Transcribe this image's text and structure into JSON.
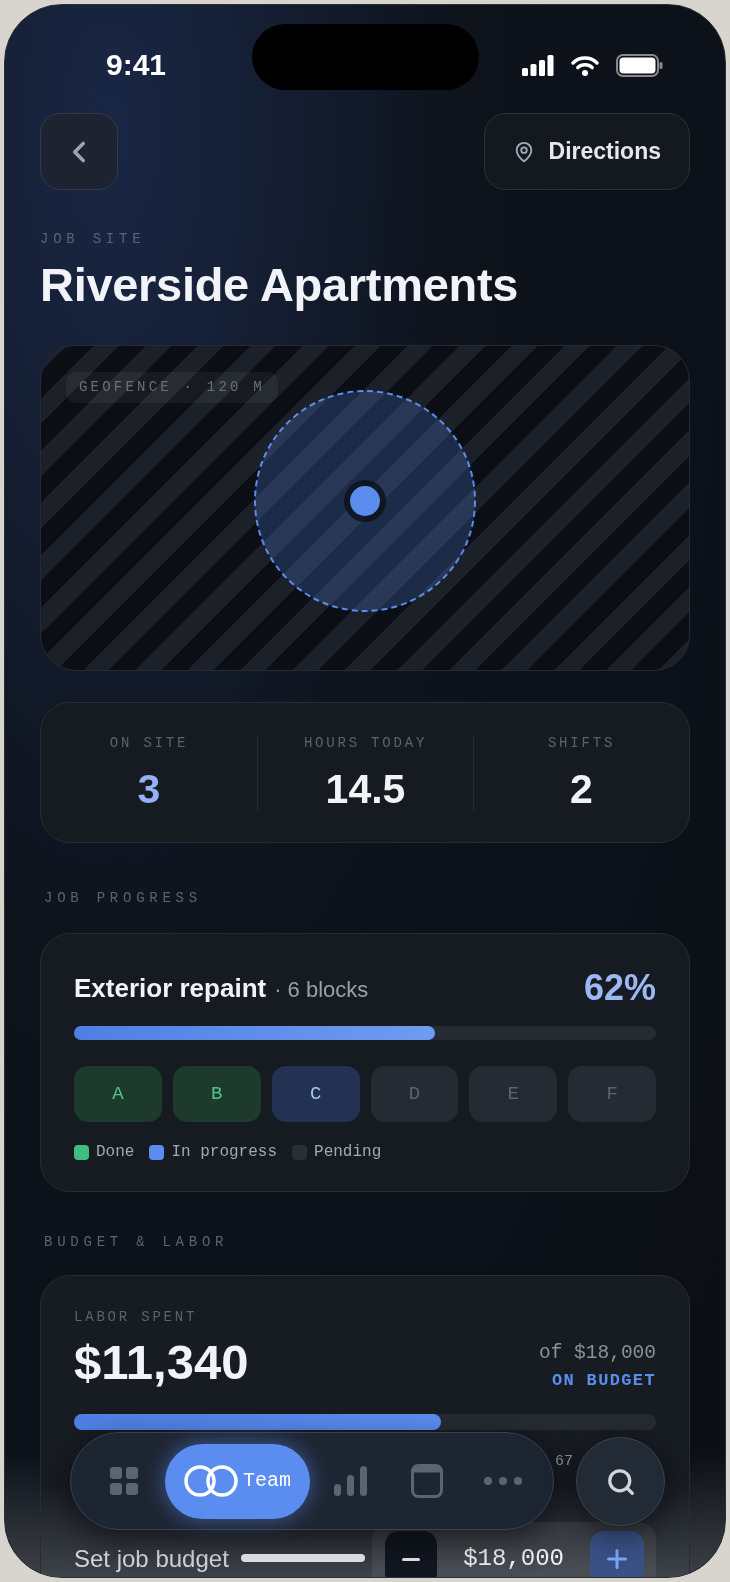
{
  "status_bar": {
    "time": "9:41"
  },
  "header": {
    "directions": "Directions"
  },
  "job_site": {
    "eyebrow": "JOB SITE",
    "title": "Riverside Apartments"
  },
  "map": {
    "label": "GEOFENCE · 120 M"
  },
  "stats": [
    {
      "label": "ON SITE",
      "value": "3",
      "accent": true
    },
    {
      "label": "HOURS TODAY",
      "value": "14.5",
      "accent": false
    },
    {
      "label": "SHIFTS",
      "value": "2",
      "accent": false
    }
  ],
  "job_progress": {
    "heading": "JOB PROGRESS",
    "task": "Exterior repaint",
    "detail": "· 6 blocks",
    "percent": "62%",
    "level": 0.62,
    "blocks": [
      {
        "label": "A",
        "done": true,
        "active": false
      },
      {
        "label": "B",
        "done": true,
        "active": false
      },
      {
        "label": "C",
        "done": false,
        "active": true
      },
      {
        "label": "D",
        "done": false,
        "active": false
      },
      {
        "label": "E",
        "done": false,
        "active": false
      },
      {
        "label": "F",
        "done": false,
        "active": false
      }
    ],
    "legend": [
      {
        "label": "Done",
        "color": "#3fbf7f"
      },
      {
        "label": "In progress",
        "color": "#5b8def"
      },
      {
        "label": "Pending",
        "color": "#2a2e36"
      }
    ]
  },
  "budget": {
    "heading": "BUDGET & LABOR",
    "label": "LABOR SPENT",
    "amount": "$11,340",
    "total": "of $18,000",
    "status": "ON BUDGET",
    "level": 0.63,
    "cut_off_text": "67",
    "set_label": "Set job budget",
    "set_value": "$18,000"
  },
  "nav": {
    "items": [
      {
        "kind": "grid",
        "selected": false
      },
      {
        "kind": "team",
        "label": "Team",
        "selected": true
      },
      {
        "kind": "chart",
        "selected": false
      },
      {
        "kind": "window",
        "selected": false
      },
      {
        "kind": "more",
        "selected": false
      }
    ]
  }
}
